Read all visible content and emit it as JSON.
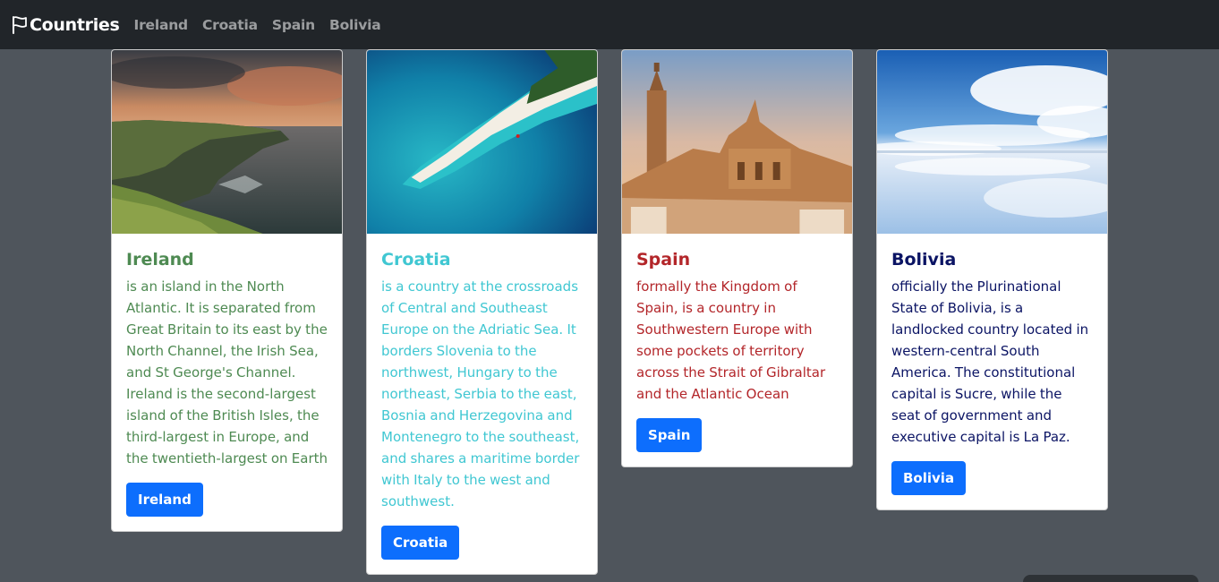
{
  "navbar": {
    "brand": "Countries",
    "links": [
      "Ireland",
      "Croatia",
      "Spain",
      "Bolivia"
    ]
  },
  "cards": [
    {
      "title": "Ireland",
      "text": "is an island in the North Atlantic. It is separated from Great Britain to its east by the North Channel, the Irish Sea, and St George's Channel. Ireland is the second-largest island of the British Isles, the third-largest in Europe, and the twentieth-largest on Earth",
      "button": "Ireland",
      "color": "#4e8a52"
    },
    {
      "title": "Croatia",
      "text": "is a country at the crossroads of Central and Southeast Europe on the Adriatic Sea. It borders Slovenia to the northwest, Hungary to the northeast, Serbia to the east, Bosnia and Herzegovina and Montenegro to the southeast, and shares a maritime border with Italy to the west and southwest.",
      "button": "Croatia",
      "color": "#40c7d2"
    },
    {
      "title": "Spain",
      "text": "formally the Kingdom of Spain, is a country in Southwestern Europe with some pockets of territory across the Strait of Gibraltar and the Atlantic Ocean",
      "button": "Spain",
      "color": "#b3262a"
    },
    {
      "title": "Bolivia",
      "text": "officially the Plurinational State of Bolivia, is a landlocked country located in western-central South America. The constitutional capital is Sucre, while the seat of government and executive capital is La Paz.",
      "button": "Bolivia",
      "color": "#0b1464"
    }
  ]
}
